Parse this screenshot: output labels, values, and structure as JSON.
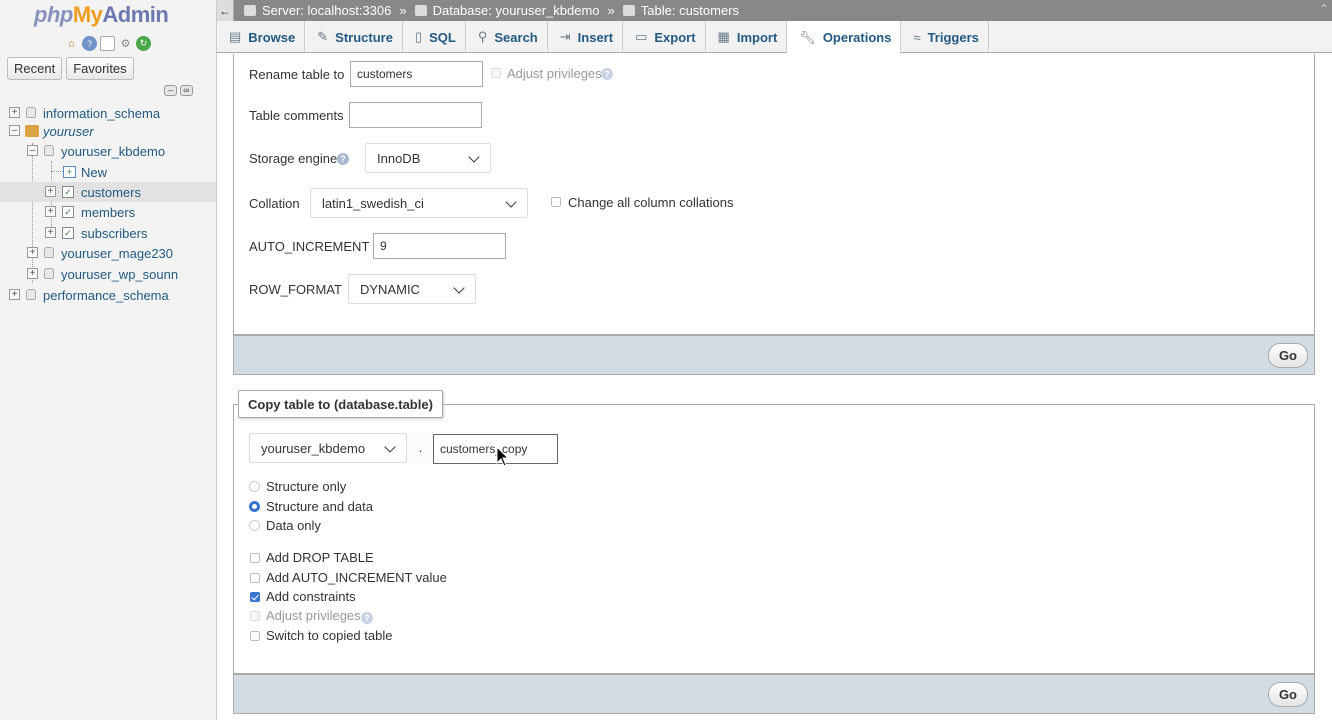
{
  "nav": {
    "logo": {
      "php": "php",
      "my": "My",
      "admin": "Admin"
    },
    "quick_icons": [
      "home-icon",
      "help-icon",
      "docs-icon",
      "settings-icon",
      "reload-icon"
    ],
    "tabs": {
      "recent": "Recent",
      "favorites": "Favorites"
    },
    "tree": {
      "information_schema": "information_schema",
      "youruser": "youruser",
      "youruser_kbdemo": "youruser_kbdemo",
      "new": "New",
      "customers": "customers",
      "members": "members",
      "subscribers": "subscribers",
      "youruser_mage230": "youruser_mage230",
      "youruser_wp_sounn": "youruser_wp_sounn",
      "performance_schema": "performance_schema"
    }
  },
  "breadcrumb": {
    "server": "Server: localhost:3306",
    "separator": "»",
    "database": "Database: youruser_kbdemo",
    "table": "Table: customers"
  },
  "menu": {
    "browse": "Browse",
    "structure": "Structure",
    "sql": "SQL",
    "search": "Search",
    "insert": "Insert",
    "export": "Export",
    "import": "Import",
    "operations": "Operations",
    "triggers": "Triggers"
  },
  "options": {
    "rename_label": "Rename table to",
    "rename_value": "customers",
    "adjust_privileges": "Adjust privileges",
    "comments_label": "Table comments",
    "comments_value": "",
    "engine_label": "Storage engine",
    "engine_value": "InnoDB",
    "collation_label": "Collation",
    "collation_value": "latin1_swedish_ci",
    "change_all_collations": "Change all column collations",
    "auto_increment_label": "AUTO_INCREMENT",
    "auto_increment_value": "9",
    "row_format_label": "ROW_FORMAT",
    "row_format_value": "DYNAMIC",
    "go": "Go"
  },
  "copy": {
    "legend": "Copy table to (database.table)",
    "database_value": "youruser_kbdemo",
    "dot": ".",
    "table_value": "customers_copy",
    "structure_only": "Structure only",
    "structure_and_data": "Structure and data",
    "data_only": "Data only",
    "add_drop_table": "Add DROP TABLE",
    "add_auto_increment": "Add AUTO_INCREMENT value",
    "add_constraints": "Add constraints",
    "adjust_privileges": "Adjust privileges",
    "switch_to_copied": "Switch to copied table",
    "go": "Go"
  },
  "colors": {
    "link": "#235a81",
    "accent": "#3b73d1",
    "footer": "#d3dce3",
    "topbar": "#888888"
  }
}
